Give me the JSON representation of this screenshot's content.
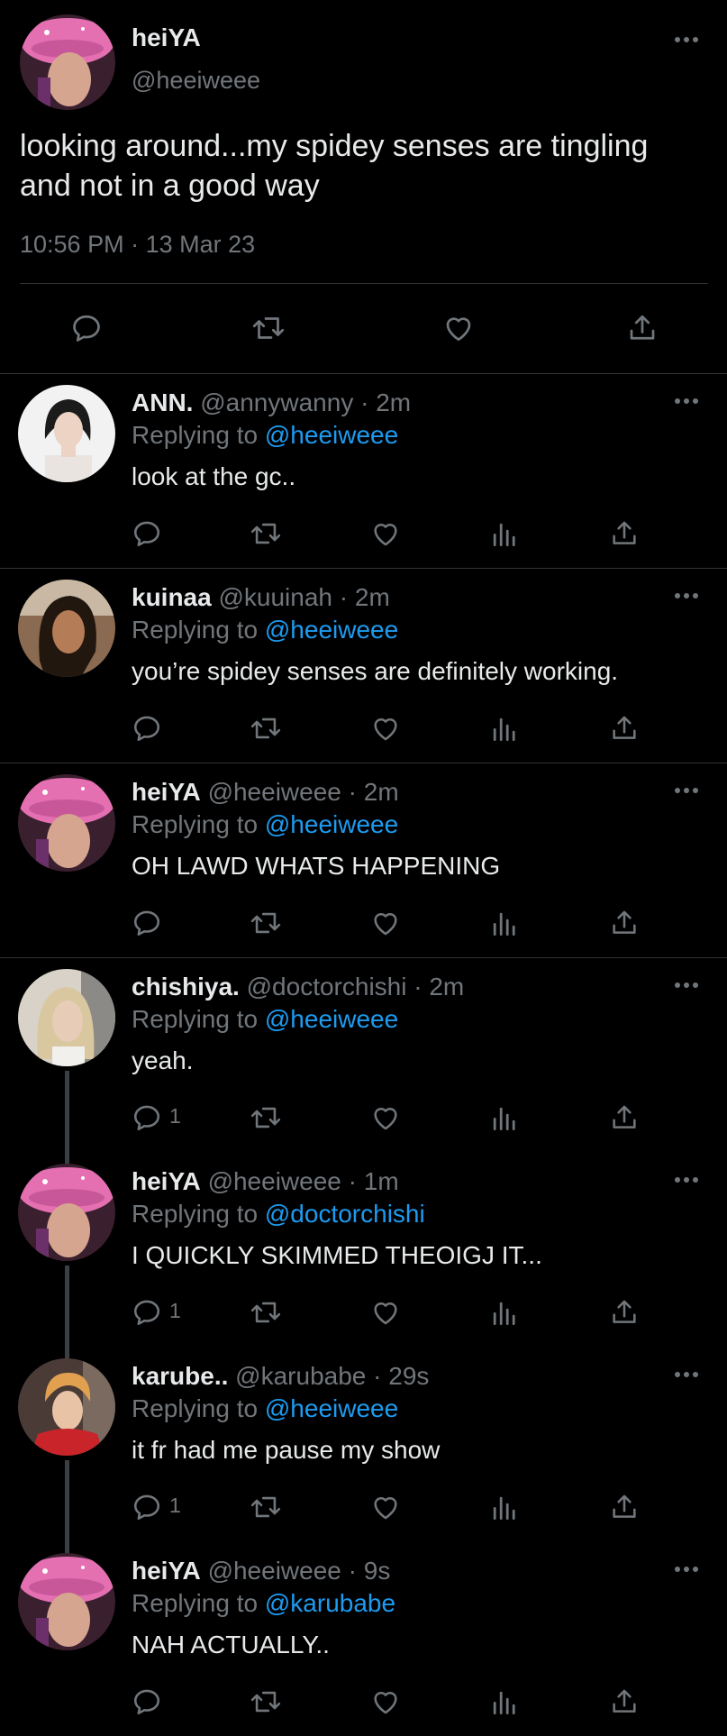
{
  "colors": {
    "background": "#000000",
    "text": "#e7e9ea",
    "muted": "#71767b",
    "link": "#1d9bf0",
    "divider": "#2f3336"
  },
  "main_tweet": {
    "name": "heiYA",
    "handle": "@heeiweee",
    "text": "looking around...my spidey senses are tingling and not in a good way",
    "time": "10:56 PM",
    "date": "13 Mar 23",
    "date_sep": "·",
    "icons": [
      "reply-icon",
      "retweet-icon",
      "like-icon",
      "share-icon"
    ]
  },
  "replies": [
    {
      "name": "ANN.",
      "handle": "@annywanny",
      "sep": "·",
      "time": "2m",
      "replying_label": "Replying to ",
      "replying_to": "@heeiweee",
      "text": "look at the gc..",
      "reply_count": ""
    },
    {
      "name": "kuinaa",
      "handle": "@kuuinah",
      "sep": "·",
      "time": "2m",
      "replying_label": "Replying to ",
      "replying_to": "@heeiweee",
      "text": "you’re spidey senses are definitely working.",
      "reply_count": ""
    },
    {
      "name": "heiYA",
      "handle": "@heeiweee",
      "sep": "·",
      "time": "2m",
      "replying_label": "Replying to ",
      "replying_to": "@heeiweee",
      "text": "OH LAWD WHATS HAPPENING",
      "reply_count": ""
    },
    {
      "name": "chishiya.",
      "handle": "@doctorchishi",
      "sep": "·",
      "time": "2m",
      "replying_label": "Replying to ",
      "replying_to": "@heeiweee",
      "text": "yeah.",
      "reply_count": "1"
    },
    {
      "name": "heiYA",
      "handle": "@heeiweee",
      "sep": "·",
      "time": "1m",
      "replying_label": "Replying to ",
      "replying_to": "@doctorchishi",
      "text": "I QUICKLY SKIMMED THEOIGJ IT...",
      "reply_count": "1"
    },
    {
      "name": "karube..",
      "handle": "@karubabe",
      "sep": "·",
      "time": "29s",
      "replying_label": "Replying to ",
      "replying_to": "@heeiweee",
      "text": "it fr had me pause my show",
      "reply_count": "1"
    },
    {
      "name": "heiYA",
      "handle": "@heeiweee",
      "sep": "·",
      "time": "9s",
      "replying_label": "Replying to ",
      "replying_to": "@karubabe",
      "text": "NAH ACTUALLY..",
      "reply_count": ""
    }
  ],
  "reply_action_icons": [
    "reply-icon",
    "retweet-icon",
    "like-icon",
    "analytics-icon",
    "share-icon"
  ]
}
